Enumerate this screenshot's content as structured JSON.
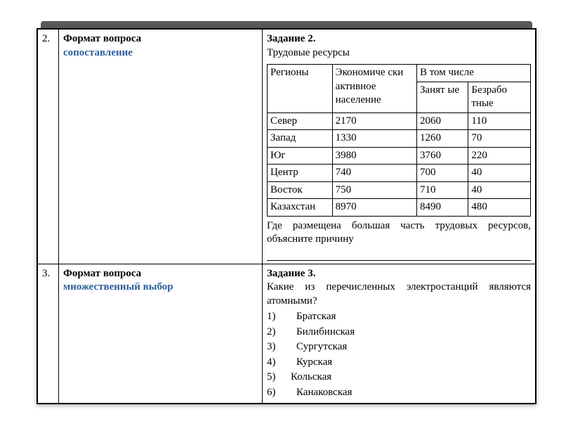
{
  "rows": [
    {
      "num": "2.",
      "format_label": "Формат вопроса",
      "format_type": "сопоставление",
      "task_title": "Задание 2.",
      "task_subtitle": "Трудовые ресурсы",
      "question": "Где размещена большая часть трудовых ресурсов, объясните причину"
    },
    {
      "num": "3.",
      "format_label": "Формат вопроса",
      "format_type": "множественный выбор",
      "task_title": "Задание 3.",
      "task_question": "Какие из перечисленных электростанций являются атомными?",
      "options": [
        {
          "n": "1)",
          "text": "Братская"
        },
        {
          "n": "2)",
          "text": "Билибинская"
        },
        {
          "n": "3)",
          "text": "Сургутская"
        },
        {
          "n": "4)",
          "text": "Курская"
        },
        {
          "n": "5)",
          "text": "Кольская"
        },
        {
          "n": "6)",
          "text": "Канаковская"
        }
      ]
    }
  ],
  "chart_data": {
    "type": "table",
    "headers": {
      "region": "Регионы",
      "active": "Экономиче ски активное население",
      "including": "В том числе",
      "employed": "Занят ые",
      "unemployed": "Безрабо тные"
    },
    "rows": [
      {
        "region": "Север",
        "active": "2170",
        "employed": "2060",
        "unemployed": "110"
      },
      {
        "region": "Запад",
        "active": "1330",
        "employed": "1260",
        "unemployed": "70"
      },
      {
        "region": "Юг",
        "active": "3980",
        "employed": "3760",
        "unemployed": "220"
      },
      {
        "region": "Центр",
        "active": "740",
        "employed": "700",
        "unemployed": "40"
      },
      {
        "region": "Восток",
        "active": "750",
        "employed": "710",
        "unemployed": "40"
      },
      {
        "region": "Казахстан",
        "active": "8970",
        "employed": "8490",
        "unemployed": "480"
      }
    ]
  }
}
